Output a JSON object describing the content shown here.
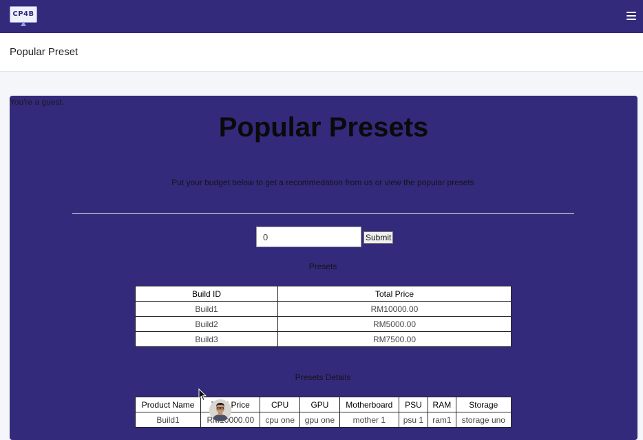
{
  "app": {
    "logo_text": "CP4B"
  },
  "header": {
    "title": "Popular Preset"
  },
  "guest_notice": "You're a guest.",
  "main": {
    "heading": "Popular Presets",
    "subtitle": "Put your budget below to get a recommedation from us or view the popular presets",
    "budget": {
      "value": "0",
      "submit_label": "Submit"
    },
    "presets_label": "Presets",
    "presets_table": {
      "columns": [
        "Build ID",
        "Total Price"
      ],
      "rows": [
        [
          "Build1",
          "RM10000.00"
        ],
        [
          "Build2",
          "RM5000.00"
        ],
        [
          "Build3",
          "RM7500.00"
        ]
      ]
    },
    "details_label": "Presets Details",
    "details_table": {
      "columns": [
        "Product Name",
        "Total Price",
        "CPU",
        "GPU",
        "Motherboard",
        "PSU",
        "RAM",
        "Storage"
      ],
      "rows": [
        [
          "Build1",
          "RM10000.00",
          "cpu one",
          "gpu one",
          "mother 1",
          "psu 1",
          "ram1",
          "storage uno"
        ]
      ]
    }
  },
  "icons": {
    "menu": "hamburger-menu-icon",
    "cursor": "mouse-pointer-icon",
    "avatar": "user-avatar"
  },
  "colors": {
    "topbar": "#332a7c",
    "panel": "#332a7c",
    "page_background": "#f4f6f9"
  }
}
